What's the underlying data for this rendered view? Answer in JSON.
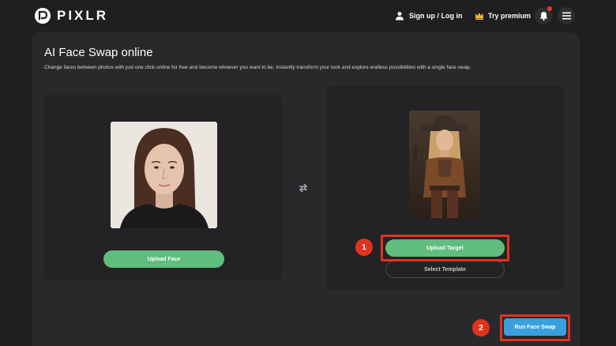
{
  "header": {
    "logo_text": "PIXLR",
    "signup_label": "Sign up / Log in",
    "premium_label": "Try premium",
    "icons": [
      "logo-icon",
      "user-icon",
      "crown-icon",
      "bell-icon",
      "menu-icon"
    ],
    "notification_color": "#e53935"
  },
  "main": {
    "title": "AI Face Swap online",
    "description": "Change faces between photos with just one click online for free and become whoever you want to be. Instantly transform your look and explore endless possibilities with a single face swap.",
    "source_card": {
      "upload_label": "Upload Face"
    },
    "target_card": {
      "upload_label": "Upload Target",
      "template_label": "Select Template"
    },
    "swap_icon": "swap-arrows-icon",
    "run_label": "Run Face Swap"
  },
  "annotations": {
    "step_1": "1",
    "step_2": "2",
    "highlight_color": "#e0331f"
  },
  "colors": {
    "accent_green": "#5fbd7e",
    "accent_blue": "#3aa0dc",
    "background": "#1f1f21",
    "panel": "#29292c"
  }
}
